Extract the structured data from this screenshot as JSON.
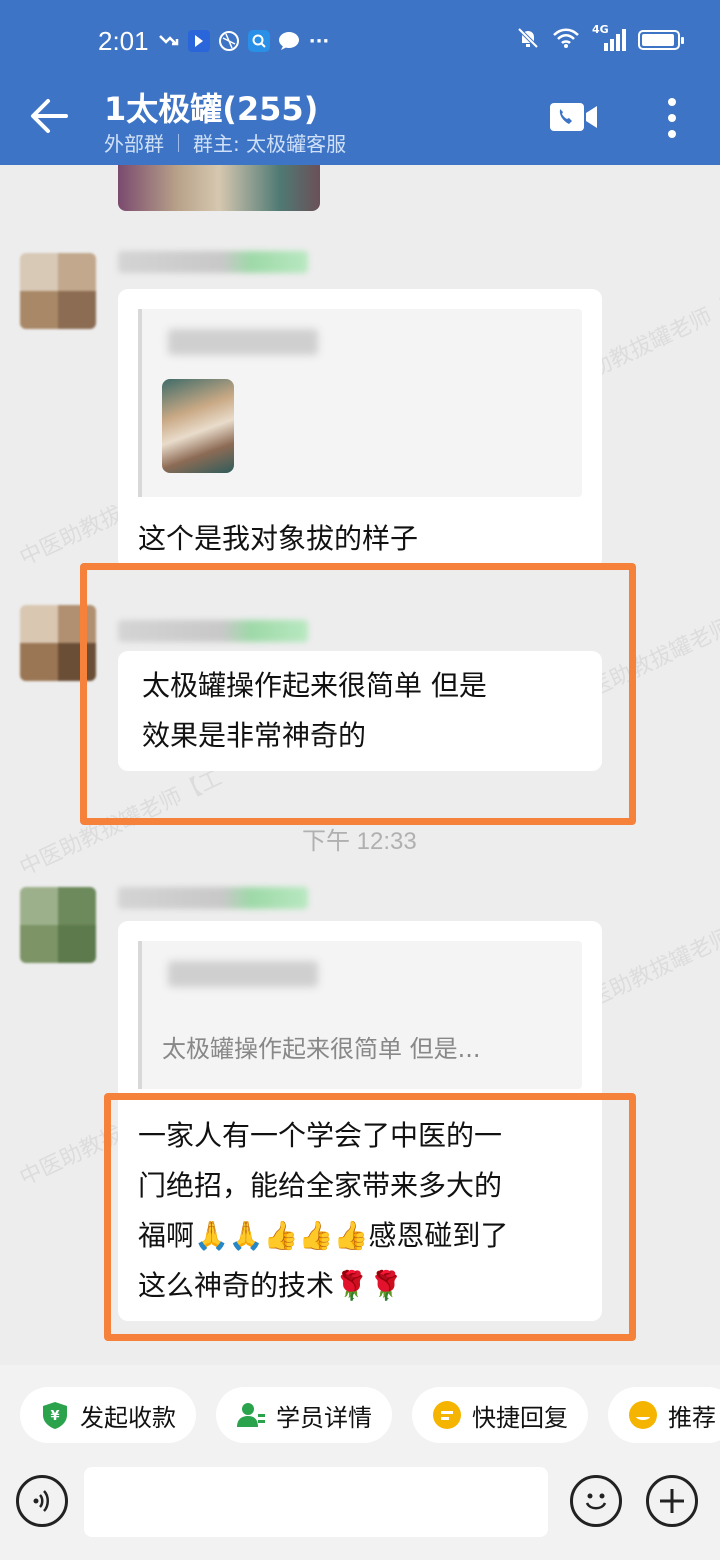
{
  "status_bar": {
    "time": "2:01",
    "network": "4G"
  },
  "header": {
    "title": "1太极罐(255)",
    "tag": "外部群",
    "owner": "群主: 太极罐客服"
  },
  "messages": {
    "m1_quote_text": "",
    "m1_text": "这个是我对象拔的样子",
    "m2_text_line1": "太极罐操作起来很简单  但是",
    "m2_text_line2": "效果是非常神奇的",
    "timestamp": "下午 12:33",
    "m3_quote_text": "太极罐操作起来很简单  但是...",
    "m3_text_line1": "一家人有一个学会了中医的一",
    "m3_text_line2": "门绝招，能给全家带来多大的",
    "m3_text_line3": "福啊🙏🙏👍👍👍感恩碰到了",
    "m3_text_line4": "这么神奇的技术🌹🌹"
  },
  "watermark": "中医助教拔罐老师【工",
  "quick_actions": [
    {
      "label": "发起收款",
      "color": "#2ba24c"
    },
    {
      "label": "学员详情",
      "color": "#2ba24c"
    },
    {
      "label": "快捷回复",
      "color": "#f5b400"
    },
    {
      "label": "推荐",
      "color": "#f5b400"
    }
  ],
  "input": {
    "placeholder": ""
  }
}
